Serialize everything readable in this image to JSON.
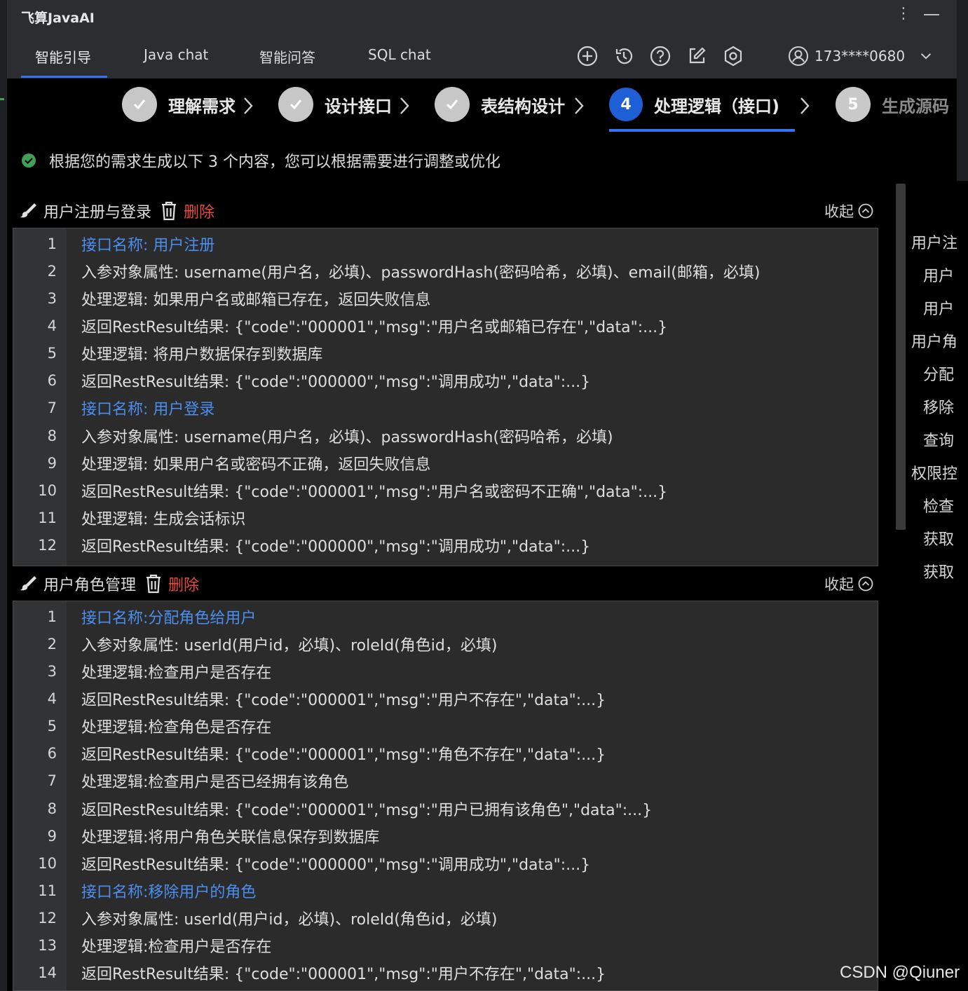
{
  "app": {
    "title": "飞算JavaAI"
  },
  "tabs": [
    "智能引导",
    "Java chat",
    "智能问答",
    "SQL chat"
  ],
  "toolbar_icons": [
    "add-icon",
    "history-icon",
    "help-icon",
    "edit-icon",
    "settings-icon"
  ],
  "user": {
    "phone": "173****0680"
  },
  "steps": [
    {
      "num": "",
      "label": "理解需求",
      "status": "done"
    },
    {
      "num": "",
      "label": "设计接口",
      "status": "done"
    },
    {
      "num": "",
      "label": "表结构设计",
      "status": "done"
    },
    {
      "num": "4",
      "label": "处理逻辑（接口)",
      "status": "current"
    },
    {
      "num": "5",
      "label": "生成源码",
      "status": "future"
    }
  ],
  "notice": "根据您的需求生成以下 3 个内容，您可以根据需要进行调整或优化",
  "sections": [
    {
      "title": "用户注册与登录",
      "delete_label": "删除",
      "collapse_label": "收起",
      "lines": [
        {
          "n": "1",
          "text": "接口名称: 用户注册",
          "hl": true
        },
        {
          "n": "2",
          "text": "入参对象属性: username(用户名，必填)、passwordHash(密码哈希，必填)、email(邮箱，必填)",
          "hl": false
        },
        {
          "n": "3",
          "text": "处理逻辑: 如果用户名或邮箱已存在，返回失败信息",
          "hl": false
        },
        {
          "n": "4",
          "text": "返回RestResult结果: {\"code\":\"000001\",\"msg\":\"用户名或邮箱已存在\",\"data\":...}",
          "hl": false
        },
        {
          "n": "5",
          "text": "处理逻辑: 将用户数据保存到数据库",
          "hl": false
        },
        {
          "n": "6",
          "text": "返回RestResult结果: {\"code\":\"000000\",\"msg\":\"调用成功\",\"data\":...}",
          "hl": false
        },
        {
          "n": "7",
          "text": "接口名称: 用户登录",
          "hl": true
        },
        {
          "n": "8",
          "text": "入参对象属性: username(用户名，必填)、passwordHash(密码哈希，必填)",
          "hl": false
        },
        {
          "n": "9",
          "text": "处理逻辑: 如果用户名或密码不正确，返回失败信息",
          "hl": false
        },
        {
          "n": "10",
          "text": "返回RestResult结果: {\"code\":\"000001\",\"msg\":\"用户名或密码不正确\",\"data\":...}",
          "hl": false
        },
        {
          "n": "11",
          "text": "处理逻辑: 生成会话标识",
          "hl": false
        },
        {
          "n": "12",
          "text": "返回RestResult结果: {\"code\":\"000000\",\"msg\":\"调用成功\",\"data\":...}",
          "hl": false
        }
      ]
    },
    {
      "title": "用户角色管理",
      "delete_label": "删除",
      "collapse_label": "收起",
      "lines": [
        {
          "n": "1",
          "text": "接口名称:分配角色给用户",
          "hl": true
        },
        {
          "n": "2",
          "text": "入参对象属性: userId(用户id，必填)、roleId(角色id，必填)",
          "hl": false
        },
        {
          "n": "3",
          "text": "处理逻辑:检查用户是否存在",
          "hl": false
        },
        {
          "n": "4",
          "text": "返回RestResult结果: {\"code\":\"000001\",\"msg\":\"用户不存在\",\"data\":...}",
          "hl": false
        },
        {
          "n": "5",
          "text": "处理逻辑:检查角色是否存在",
          "hl": false
        },
        {
          "n": "6",
          "text": "返回RestResult结果: {\"code\":\"000001\",\"msg\":\"角色不存在\",\"data\":...}",
          "hl": false
        },
        {
          "n": "7",
          "text": "处理逻辑:检查用户是否已经拥有该角色",
          "hl": false
        },
        {
          "n": "8",
          "text": "返回RestResult结果: {\"code\":\"000001\",\"msg\":\"用户已拥有该角色\",\"data\":...}",
          "hl": false
        },
        {
          "n": "9",
          "text": "处理逻辑:将用户角色关联信息保存到数据库",
          "hl": false
        },
        {
          "n": "10",
          "text": "返回RestResult结果: {\"code\":\"000000\",\"msg\":\"调用成功\",\"data\":...}",
          "hl": false
        },
        {
          "n": "11",
          "text": "接口名称:移除用户的角色",
          "hl": true
        },
        {
          "n": "12",
          "text": "入参对象属性: userId(用户id，必填)、roleId(角色id，必填)",
          "hl": false
        },
        {
          "n": "13",
          "text": "处理逻辑:检查用户是否存在",
          "hl": false
        },
        {
          "n": "14",
          "text": "返回RestResult结果: {\"code\":\"000001\",\"msg\":\"用户不存在\",\"data\":...}",
          "hl": false
        }
      ]
    }
  ],
  "outline": [
    {
      "text": "用户注",
      "level": 0
    },
    {
      "text": "用户",
      "level": 1
    },
    {
      "text": "用户",
      "level": 1
    },
    {
      "text": "用户角",
      "level": 0
    },
    {
      "text": "分配",
      "level": 1
    },
    {
      "text": "移除",
      "level": 1
    },
    {
      "text": "查询",
      "level": 1
    },
    {
      "text": "权限控",
      "level": 0
    },
    {
      "text": "检查",
      "level": 1
    },
    {
      "text": "获取",
      "level": 1
    },
    {
      "text": "获取",
      "level": 1
    }
  ],
  "watermark": "CSDN @Qiuner"
}
